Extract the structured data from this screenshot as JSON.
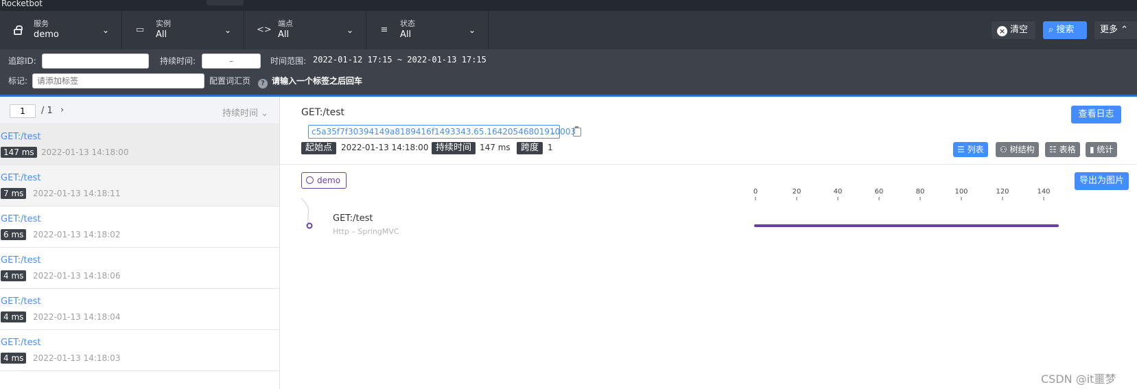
{
  "app": {
    "brand": "Rocketbot"
  },
  "filters": {
    "service": {
      "label": "服务",
      "value": "demo"
    },
    "instance": {
      "label": "实例",
      "value": "All"
    },
    "endpoint": {
      "label": "端点",
      "value": "All"
    },
    "status": {
      "label": "状态",
      "value": "All"
    }
  },
  "toolbar": {
    "clear": "清空",
    "search": "搜索",
    "more": "更多"
  },
  "advanced": {
    "trace_id_label": "追踪ID:",
    "trace_id_value": "",
    "duration_label": "持续时间:",
    "duration_placeholder": "–",
    "time_range_label": "时间范围:",
    "time_range_value": "2022-01-12 17:15 ~ 2022-01-13 17:15",
    "tags_label": "标记:",
    "tags_placeholder": "请添加标签",
    "config_link": "配置词汇页",
    "tags_hint": "请输入一个标签之后回车"
  },
  "pager": {
    "page": "1",
    "total": "/ 1",
    "sort": "持续时间"
  },
  "traces": [
    {
      "name": "GET:/test",
      "duration": "147 ms",
      "time": "2022-01-13 14:18:00"
    },
    {
      "name": "GET:/test",
      "duration": "7 ms",
      "time": "2022-01-13 14:18:11"
    },
    {
      "name": "GET:/test",
      "duration": "6 ms",
      "time": "2022-01-13 14:18:02"
    },
    {
      "name": "GET:/test",
      "duration": "4 ms",
      "time": "2022-01-13 14:18:06"
    },
    {
      "name": "GET:/test",
      "duration": "4 ms",
      "time": "2022-01-13 14:18:04"
    },
    {
      "name": "GET:/test",
      "duration": "4 ms",
      "time": "2022-01-13 14:18:03"
    }
  ],
  "detail": {
    "title": "GET:/test",
    "trace_id": "c5a35f7f30394149a8189416f1493343.65.16420546801910003",
    "start_label": "起始点",
    "start_value": "2022-01-13 14:18:00",
    "duration_label": "持续时间",
    "duration_value": "147 ms",
    "span_label": "跨度",
    "span_value": "1",
    "view_logs": "查看日志",
    "views": {
      "list": "列表",
      "tree": "树结构",
      "table": "表格",
      "stats": "统计"
    },
    "service_chip": "demo",
    "export": "导出为图片",
    "axis_ticks": [
      "0",
      "20",
      "40",
      "60",
      "80",
      "100",
      "120",
      "140"
    ],
    "span": {
      "name": "GET:/test",
      "sub": "Http – SpringMVC",
      "start_ms": 0,
      "duration_ms": 147
    }
  },
  "watermark": "CSDN @it噩梦",
  "colors": {
    "accent": "#448dfe",
    "span": "#6b3fa8",
    "dark": "#33373e"
  }
}
